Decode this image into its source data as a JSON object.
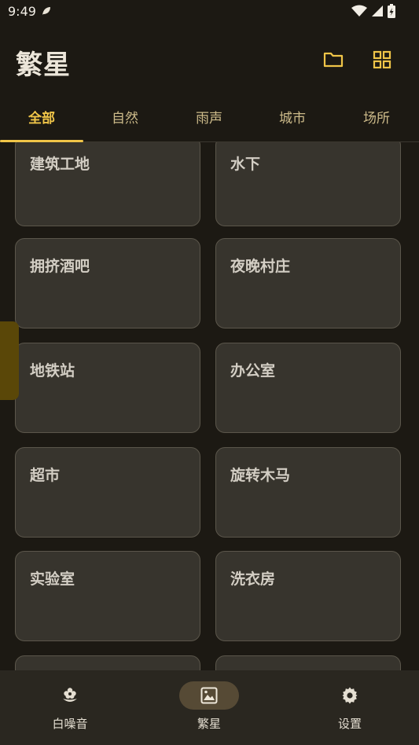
{
  "status_bar": {
    "time": "9:49",
    "icons": [
      "notification-leaf-icon",
      "wifi-icon",
      "signal-icon",
      "battery-charging-icon"
    ]
  },
  "header": {
    "title": "繁星",
    "actions": [
      "folder-icon",
      "grid-view-icon"
    ]
  },
  "tabs": [
    {
      "label": "全部",
      "active": true
    },
    {
      "label": "自然",
      "active": false
    },
    {
      "label": "雨声",
      "active": false
    },
    {
      "label": "城市",
      "active": false
    },
    {
      "label": "场所",
      "active": false
    }
  ],
  "cards": [
    {
      "label": "建筑工地"
    },
    {
      "label": "水下"
    },
    {
      "label": "拥挤酒吧"
    },
    {
      "label": "夜晚村庄"
    },
    {
      "label": "地铁站"
    },
    {
      "label": "办公室"
    },
    {
      "label": "超市"
    },
    {
      "label": "旋转木马"
    },
    {
      "label": "实验室"
    },
    {
      "label": "洗衣房"
    },
    {
      "label": ""
    },
    {
      "label": ""
    }
  ],
  "bottom_nav": [
    {
      "label": "白噪音",
      "icon": "flower-icon",
      "active": false
    },
    {
      "label": "繁星",
      "icon": "image-icon",
      "active": true
    },
    {
      "label": "设置",
      "icon": "gear-icon",
      "active": false
    }
  ],
  "colors": {
    "background": "#1c1913",
    "accent": "#f0c548",
    "card": "#37342d",
    "nav": "#2a2720"
  }
}
